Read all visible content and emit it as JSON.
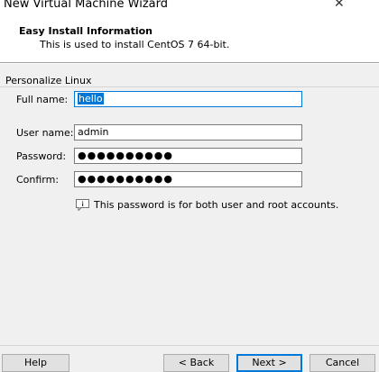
{
  "window": {
    "title": "New Virtual Machine Wizard",
    "close_glyph": "✕"
  },
  "header": {
    "title": "Easy Install Information",
    "subtitle": "This is used to install CentOS 7 64-bit."
  },
  "section": {
    "label": "Personalize Linux"
  },
  "form": {
    "full_name_label": "Full name:",
    "full_name_value": "hello",
    "user_name_label": "User name:",
    "user_name_value": "admin",
    "password_label": "Password:",
    "password_mask": "●●●●●●●●●●",
    "confirm_label": "Confirm:",
    "confirm_mask": "●●●●●●●●●●"
  },
  "info": {
    "text": "This password is for both user and root accounts.",
    "icon": "info-icon"
  },
  "buttons": {
    "help": "Help",
    "back": "< Back",
    "next": "Next >",
    "cancel": "Cancel"
  },
  "colors": {
    "accent": "#0078d7",
    "background": "#f0f0f0"
  }
}
